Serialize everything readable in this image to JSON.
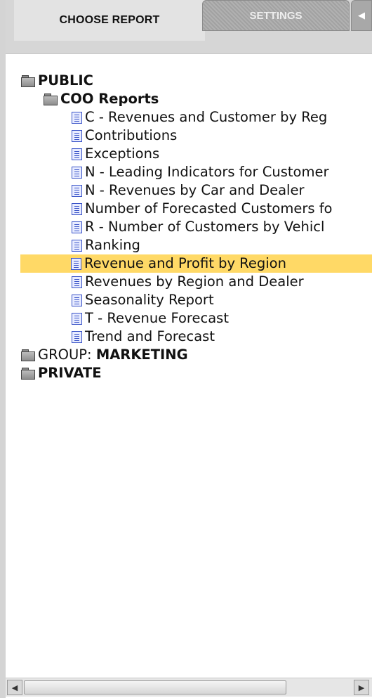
{
  "tabs": {
    "active_label": "CHOOSE REPORT",
    "inactive_label": "SETTINGS",
    "scroll_arrow": "◀"
  },
  "tree": {
    "public_label": "PUBLIC",
    "coo_label": "COO Reports",
    "reports": [
      "C - Revenues and Customer by Reg",
      "Contributions",
      "Exceptions",
      "N - Leading Indicators for Customer",
      "N - Revenues by Car and Dealer",
      "Number of Forecasted Customers fo",
      "R - Number of Customers by Vehicl",
      "Ranking",
      "Revenue and Profit by Region",
      "Revenues by Region and Dealer",
      "Seasonality Report",
      "T - Revenue Forecast",
      "Trend and Forecast"
    ],
    "selected_report": "Revenue and Profit by Region",
    "group_prefix": "GROUP: ",
    "group_name": "MARKETING",
    "private_label": "PRIVATE"
  },
  "scrollbar": {
    "left_arrow": "◀",
    "right_arrow": "▶"
  },
  "colors": {
    "highlight": "#ffd966",
    "doc_icon": "#3a54c8"
  }
}
